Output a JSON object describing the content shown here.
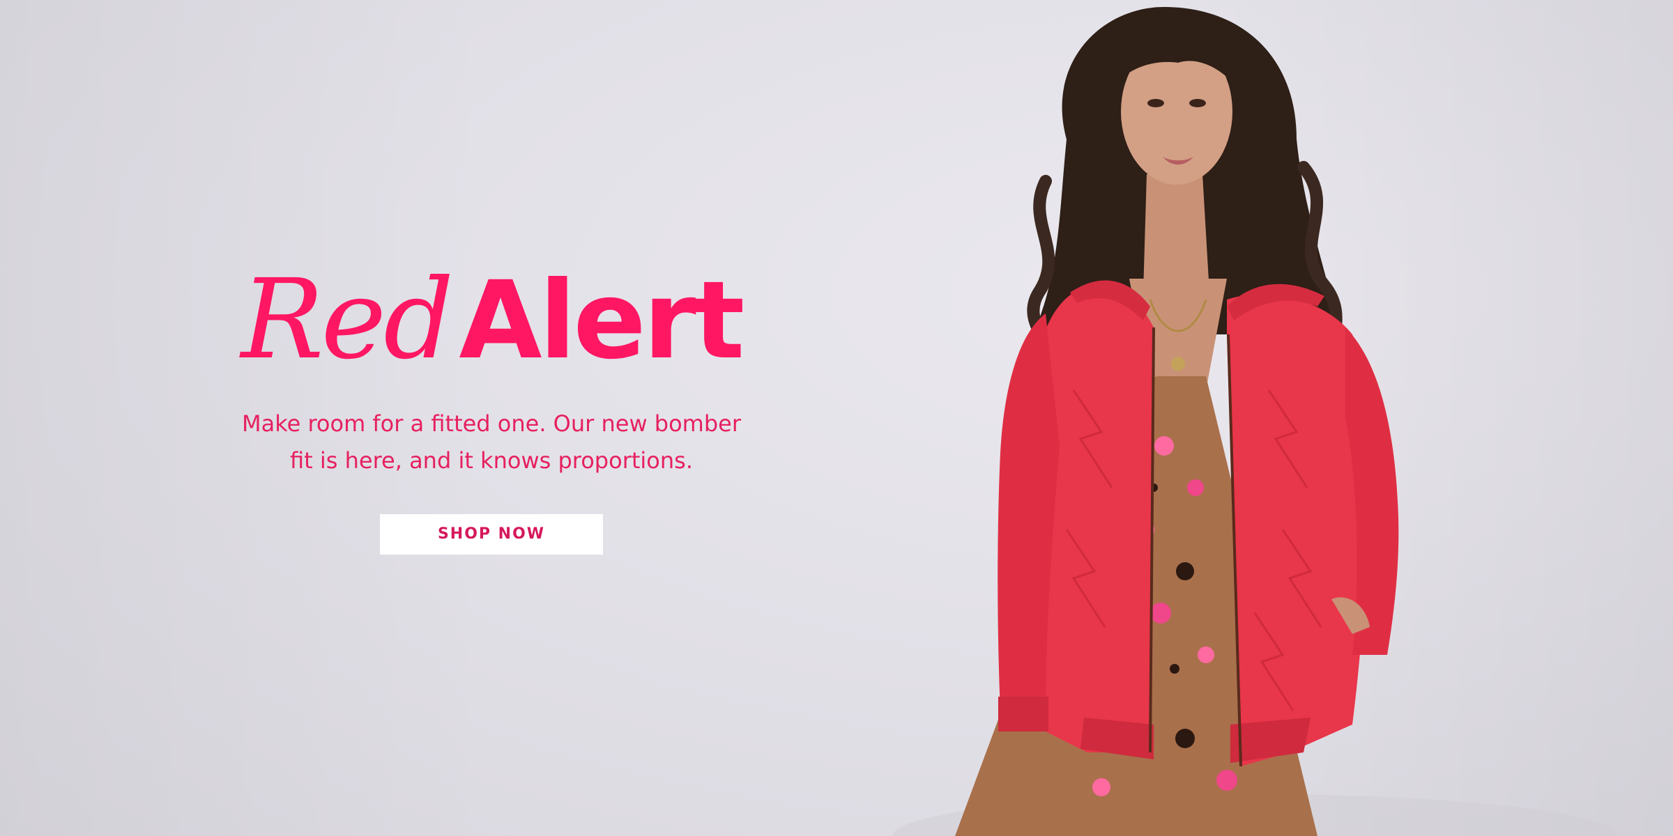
{
  "hero": {
    "headline_italic": "Red",
    "headline_bold": "Alert",
    "subtext_line1": "Make room for a fitted one. Our new bomber",
    "subtext_line2": "fit is here, and it knows proportions.",
    "cta_label": "SHOP NOW",
    "model_image_alt": "model-wearing-red-quilted-bomber-jacket"
  },
  "colors": {
    "accent": "#ff1763",
    "background": "#e3e1e8",
    "cta_background": "#ffffff",
    "jacket": "#e8364a"
  }
}
